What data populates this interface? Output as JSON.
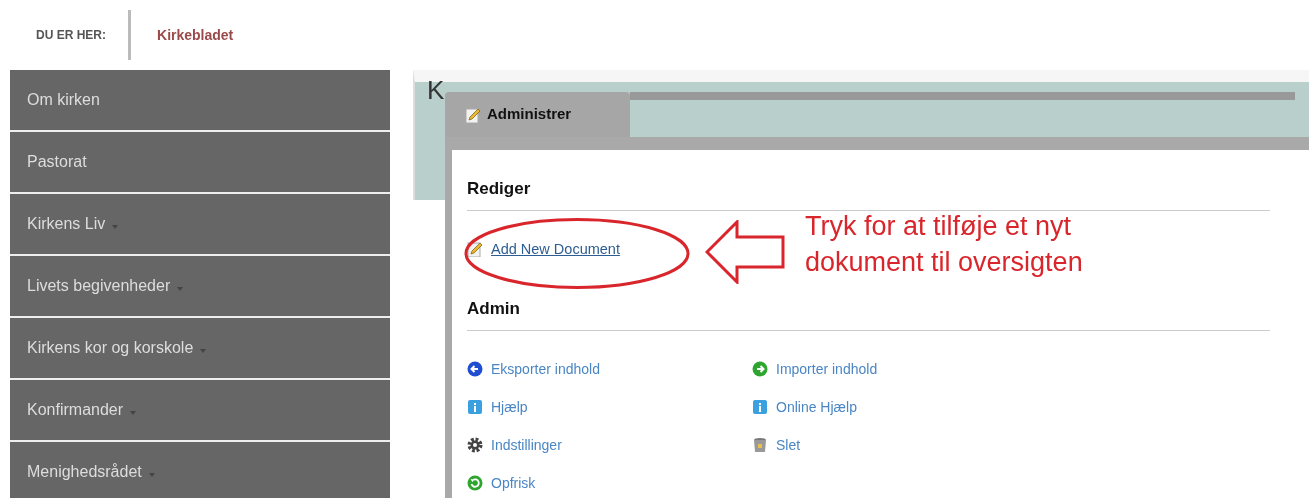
{
  "breadcrumb": {
    "label": "DU ER HER:",
    "current": "Kirkebladet"
  },
  "sidebar": {
    "items": [
      {
        "label": "Om kirken",
        "has_submenu": false
      },
      {
        "label": "Pastorat",
        "has_submenu": false
      },
      {
        "label": "Kirkens Liv",
        "has_submenu": true
      },
      {
        "label": "Livets begivenheder",
        "has_submenu": true
      },
      {
        "label": "Kirkens kor og korskole",
        "has_submenu": true
      },
      {
        "label": "Konfirmander",
        "has_submenu": true
      },
      {
        "label": "Menighedsrådet",
        "has_submenu": true
      }
    ]
  },
  "page": {
    "title": "K"
  },
  "admin_popup": {
    "tab": "Administrer",
    "sections": [
      {
        "heading": "Rediger",
        "links": [
          {
            "label": "Add New Document",
            "kind": "edit"
          }
        ]
      },
      {
        "heading": "Admin",
        "links": [
          {
            "label": "Eksporter indhold",
            "kind": "export"
          },
          {
            "label": "Importer indhold",
            "kind": "import"
          },
          {
            "label": "Hjælp",
            "kind": "help"
          },
          {
            "label": "Online Hjælp",
            "kind": "help"
          },
          {
            "label": "Indstillinger",
            "kind": "settings"
          },
          {
            "label": "Slet",
            "kind": "trash"
          },
          {
            "label": "Opfrisk",
            "kind": "refresh"
          }
        ]
      }
    ]
  },
  "annotation": {
    "text": "Tryk for at tilføje et nyt dokument til oversigten"
  }
}
